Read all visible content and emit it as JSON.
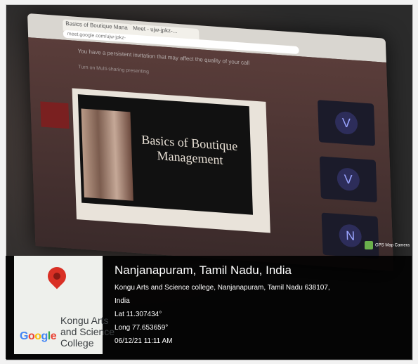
{
  "browser": {
    "tabs": [
      "Basics of Boutique Mana",
      "Meet - ujw-jpkz-..."
    ],
    "url": "meet.google.com/ujw-jpkz-",
    "notice": "You have a persistent invitation that may affect the quality of your call",
    "subnotice": "Turn on Multi-sharing presenting"
  },
  "slide": {
    "title": "Basics of Boutique Management"
  },
  "participants": [
    "V",
    "V",
    "N"
  ],
  "gps_badge": "GPS Map Camera",
  "map": {
    "label": "Kongu Arts\nand Science\nCollege",
    "logo": "Google"
  },
  "location": {
    "title": "Nanjanapuram, Tamil Nadu, India",
    "address": "Kongu Arts and Science college, Nanjanapuram, Tamil Nadu 638107,",
    "country": "India",
    "lat": "Lat 11.307434°",
    "long": "Long 77.653659°",
    "datetime": "06/12/21 11:11 AM"
  },
  "colors": {
    "pin": "#d93025",
    "overlay": "#000000"
  }
}
